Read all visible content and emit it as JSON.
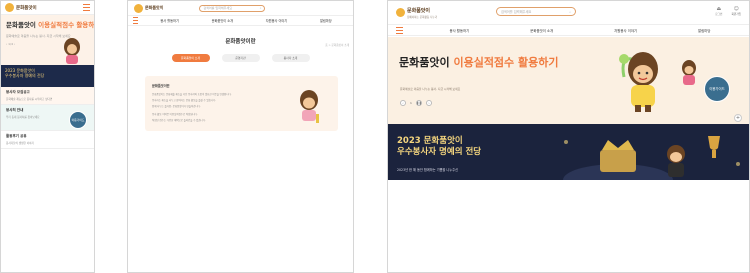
{
  "site": {
    "logo_text": "문화품앗이",
    "logo_subtitle": "집에서하는 문화활동 나누기"
  },
  "search": {
    "placeholder": "검색어를 입력해주세요"
  },
  "utils": [
    {
      "label": "로그인",
      "icon": "login-icon"
    },
    {
      "label": "회원가입",
      "icon": "user-icon"
    }
  ],
  "gnb": [
    "봉사 활동하기",
    "문화품앗이 소개",
    "자원봉사 이야기",
    "알림마당"
  ],
  "hero": {
    "title_prefix": "문화품앗이",
    "title_highlight": "이용실적점수 활용하기",
    "desc": "문화예술로 마음을 나누는 봉사, 지금 시작해 보세요",
    "page_current": "1",
    "page_total": "4"
  },
  "banner": {
    "title_line1": "2023 문화품앗이",
    "title_line2": "우수봉사자 명예의 전당",
    "subtitle": "2023년 한 해 동안 함께하는 기쁨을 나누주신"
  },
  "guide_badge": {
    "line1": "이용가이드",
    "line2": "이용가이드"
  },
  "mobile_sections": [
    {
      "title": "봉사자 모집공고",
      "desc": "문화예술 재능으로 봉사를 시작하고 싶다면"
    },
    {
      "title": "봉사처 안내",
      "desc": "우리 동네 봉사처를 찾아보세요"
    },
    {
      "title": "활동후기 공유",
      "desc": "봉사자들의 생생한 이야기"
    }
  ],
  "about_page": {
    "title": "문화품앗이란",
    "breadcrumb": "홈 > 문화품앗이 소개",
    "tabs": [
      {
        "label": "문화품앗이 소개",
        "active": true
      },
      {
        "label": "운영기관",
        "active": false
      },
      {
        "label": "봉사자 소개",
        "active": false
      }
    ],
    "card_title": "문화품앗이란",
    "card_lines": [
      "문화품앗이는 문화예술 재능을 가진 봉사자와 도움이 필요한 이웃을 연결합니다.",
      "봉사자는 재능을 나누고 참여자는 문화 활동을 즐길 수 있습니다.",
      "함께 나누는 즐거움, 문화품앗이가 만들어갑니다.",
      "봉사 활동 이력은 이용실적점수로 적립됩니다.",
      "적립된 점수는 다양한 혜택으로 돌려받을 수 있습니다."
    ]
  }
}
